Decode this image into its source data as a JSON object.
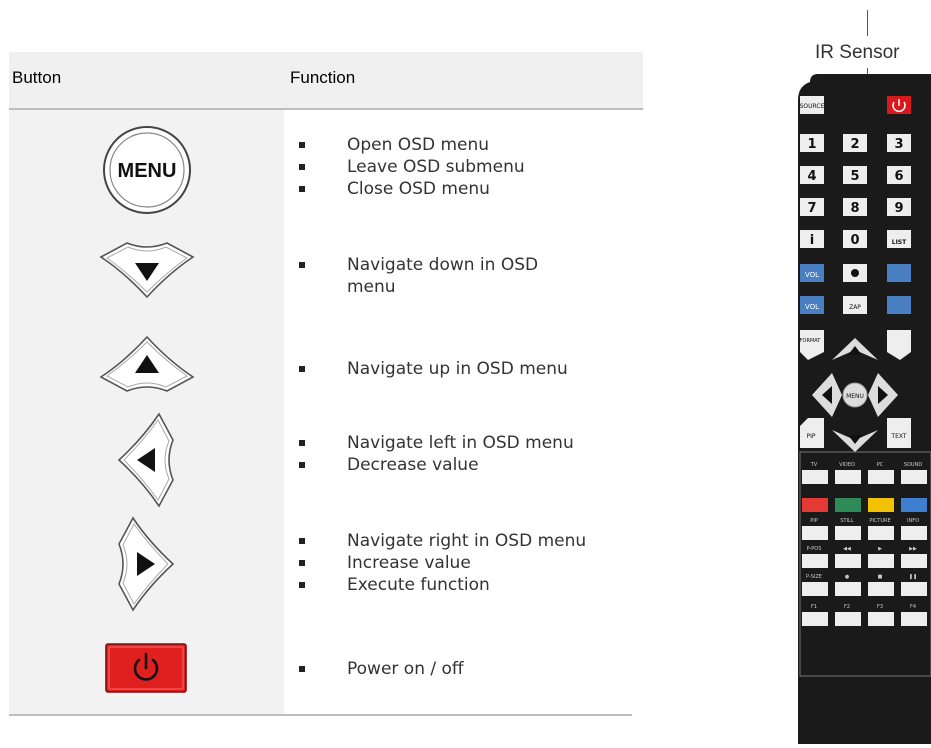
{
  "table": {
    "header": {
      "button": "Button",
      "function": "Function"
    },
    "rows": [
      {
        "button_label": "MENU",
        "button_type": "menu-button",
        "functions": [
          "Open OSD menu",
          "Leave OSD submenu",
          "Close OSD menu"
        ]
      },
      {
        "button_type": "down-arrow-button",
        "functions": [
          "Navigate down in OSD\nmenu"
        ]
      },
      {
        "button_type": "up-arrow-button",
        "functions": [
          "Navigate up in OSD menu"
        ]
      },
      {
        "button_type": "left-arrow-button",
        "functions": [
          "Navigate left in OSD menu",
          "Decrease value"
        ]
      },
      {
        "button_type": "right-arrow-button",
        "functions": [
          "Navigate right in OSD menu",
          "Increase value",
          "Execute function"
        ]
      },
      {
        "button_type": "power-button",
        "functions": [
          "Power on / off"
        ]
      }
    ]
  },
  "remote": {
    "sensor_label": "IR Sensor",
    "source_label": "SOURCE",
    "digits": [
      "1",
      "2",
      "3",
      "4",
      "5",
      "6",
      "7",
      "8",
      "9",
      "i",
      "0",
      "LIST"
    ],
    "vol_up": "VOL",
    "vol_down": "VOL",
    "zap": "ZAP",
    "format": "FORMAT",
    "menu": "MENU",
    "pip": "PIP",
    "text": "TEXT",
    "source_row": [
      "TV",
      "VIDEO",
      "PC",
      "SOUND"
    ],
    "color_keys": [
      "#e53935",
      "#2e8b57",
      "#f2c200",
      "#3f7fd0"
    ],
    "media_row1": [
      "PIP",
      "STILL",
      "PICTURE",
      "INFO"
    ],
    "media_row2": [
      "P-POS",
      "◀◀",
      "▶",
      "▶▶"
    ],
    "media_row3": [
      "P-SIZE",
      "●",
      "■",
      "❚❚"
    ],
    "f_keys": [
      "F1",
      "F2",
      "F3",
      "F4"
    ]
  },
  "colors": {
    "power_red": "#e0201e",
    "key_blue": "#4a7fc1"
  }
}
